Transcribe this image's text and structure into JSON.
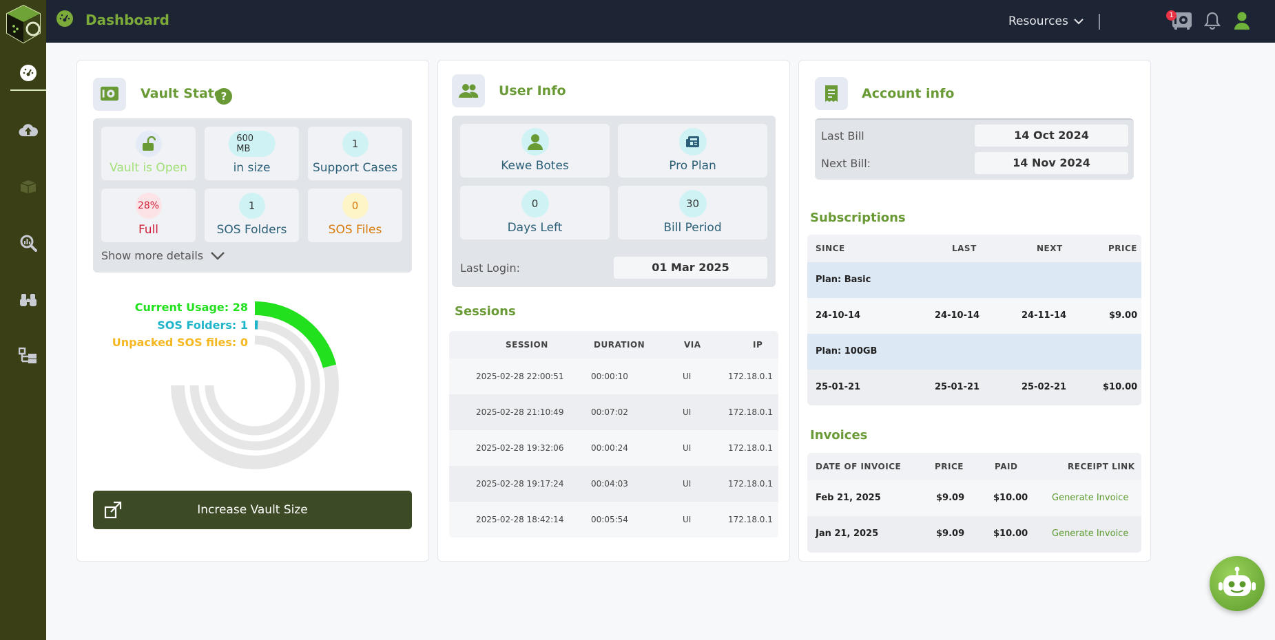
{
  "topbar": {
    "title": "Dashboard",
    "resources_label": "Resources",
    "notification_count": "1"
  },
  "sidebar": {
    "items": [
      {
        "icon": "dashboard-icon",
        "active": true
      },
      {
        "icon": "cloud-upload-icon"
      },
      {
        "icon": "box-icon"
      },
      {
        "icon": "search-analytics-icon"
      },
      {
        "icon": "binoculars-icon"
      },
      {
        "icon": "hierarchy-icon"
      }
    ]
  },
  "vault": {
    "title": "Vault State",
    "help": "?",
    "tiles": [
      {
        "value": "",
        "label": "Vault is Open"
      },
      {
        "value": "600 MB",
        "label": "in size"
      },
      {
        "value": "1",
        "label": "Support Cases"
      },
      {
        "value": "28%",
        "label": "Full"
      },
      {
        "value": "1",
        "label": "SOS Folders"
      },
      {
        "value": "0",
        "label": "SOS Files"
      }
    ],
    "show_more": "Show more details",
    "legend": {
      "current_usage": "Current Usage: 28",
      "sos_folders": "SOS Folders: 1",
      "unpacked": "Unpacked SOS files: 0"
    },
    "usage": {
      "current_usage": 28,
      "sos_folders": 1,
      "unpacked_sos_files": 0
    },
    "increase_button": "Increase Vault Size"
  },
  "user_info": {
    "title": "User Info",
    "tiles": [
      {
        "value": "",
        "label": "Kewe Botes"
      },
      {
        "value": "",
        "label": "Pro Plan"
      },
      {
        "value": "0",
        "label": "Days Left"
      },
      {
        "value": "30",
        "label": "Bill Period"
      }
    ],
    "last_login_label": "Last Login:",
    "last_login_value": "01 Mar 2025"
  },
  "sessions": {
    "title": "Sessions",
    "columns": [
      "SESSION",
      "DURATION",
      "VIA",
      "IP"
    ],
    "rows": [
      [
        "2025-02-28 22:00:51",
        "00:00:10",
        "UI",
        "172.18.0.1"
      ],
      [
        "2025-02-28 21:10:49",
        "00:07:02",
        "UI",
        "172.18.0.1"
      ],
      [
        "2025-02-28 19:32:06",
        "00:00:24",
        "UI",
        "172.18.0.1"
      ],
      [
        "2025-02-28 19:17:24",
        "00:04:03",
        "UI",
        "172.18.0.1"
      ],
      [
        "2025-02-28 18:42:14",
        "00:05:54",
        "UI",
        "172.18.0.1"
      ]
    ]
  },
  "account": {
    "title": "Account info",
    "last_bill_label": "Last Bill",
    "last_bill_value": "14 Oct 2024",
    "next_bill_label": "Next Bill:",
    "next_bill_value": "14 Nov 2024"
  },
  "subscriptions": {
    "title": "Subscriptions",
    "columns": [
      "SINCE",
      "LAST",
      "NEXT",
      "PRICE"
    ],
    "plans": [
      {
        "name": "Plan: Basic",
        "row": [
          "24-10-14",
          "24-10-14",
          "24-11-14",
          "$9.00"
        ]
      },
      {
        "name": "Plan: 100GB",
        "row": [
          "25-01-21",
          "25-01-21",
          "25-02-21",
          "$10.00"
        ]
      }
    ]
  },
  "invoices": {
    "title": "Invoices",
    "columns": [
      "DATE OF INVOICE",
      "PRICE",
      "PAID",
      "RECEIPT LINK"
    ],
    "rows": [
      [
        "Feb 21, 2025",
        "$9.09",
        "$10.00",
        "Generate Invoice"
      ],
      [
        "Jan 21, 2025",
        "$9.09",
        "$10.00",
        "Generate Invoice"
      ]
    ]
  },
  "colors": {
    "accent": "#6a9a36",
    "sidebar": "#3a3f16",
    "topbar": "#1d2433",
    "usage_green": "#22e01e",
    "folders_teal": "#1fb5c9",
    "unpacked_yellow": "#f5b820"
  }
}
